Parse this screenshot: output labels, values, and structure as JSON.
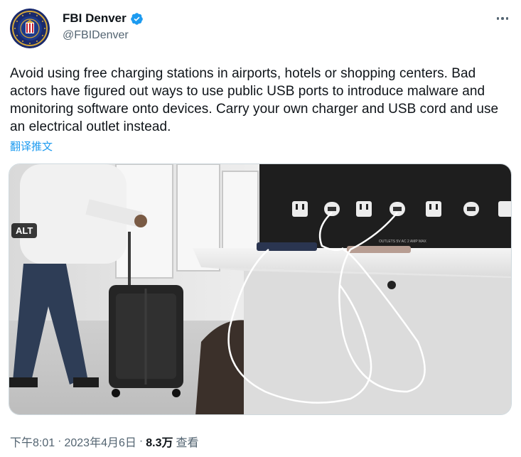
{
  "author": {
    "name": "FBI Denver",
    "handle": "@FBIDenver",
    "verified_icon": "verified-badge-icon",
    "accent": "#1d9bf0"
  },
  "tweet": {
    "text": "Avoid using free charging stations in airports, hotels or shopping centers. Bad actors have figured out ways to use public USB ports to introduce malware and monitoring software onto devices. Carry your own charger and USB cord and use an electrical outlet instead.",
    "translate_label": "翻译推文"
  },
  "media": {
    "alt_label": "ALT",
    "panel_label": "OUTLETS 5V AC 2 AMP MAX"
  },
  "meta": {
    "time": "下午8:01",
    "separator": "·",
    "date": "2023年4月6日",
    "views_count": "8.3万",
    "views_label": "查看"
  }
}
